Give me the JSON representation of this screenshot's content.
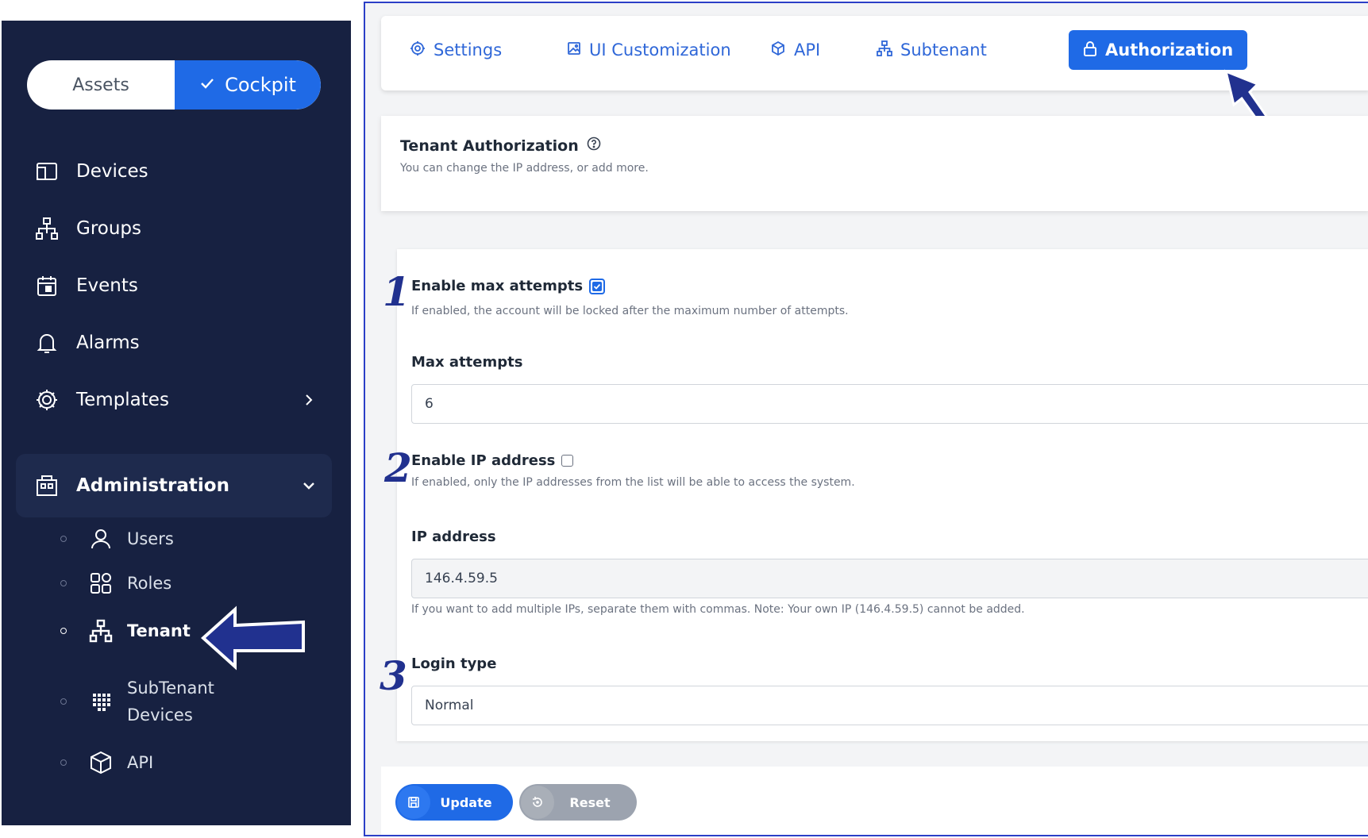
{
  "sidebar": {
    "switch": {
      "assets": "Assets",
      "cockpit": "Cockpit"
    },
    "items": [
      {
        "label": "Devices",
        "icon": "devices-icon"
      },
      {
        "label": "Groups",
        "icon": "groups-icon"
      },
      {
        "label": "Events",
        "icon": "calendar-icon"
      },
      {
        "label": "Alarms",
        "icon": "bell-icon"
      },
      {
        "label": "Templates",
        "icon": "gear-icon"
      },
      {
        "label": "Administration",
        "icon": "admin-icon"
      }
    ],
    "sub_items": [
      {
        "label": "Users",
        "icon": "user-icon"
      },
      {
        "label": "Roles",
        "icon": "roles-icon"
      },
      {
        "label": "Tenant",
        "icon": "tenant-icon"
      },
      {
        "label_line1": "SubTenant",
        "label_line2": "Devices",
        "icon": "grid-icon"
      },
      {
        "label": "API",
        "icon": "cube-icon"
      }
    ]
  },
  "tabs": [
    {
      "label": "Settings",
      "icon": "gear-icon"
    },
    {
      "label": "UI Customization",
      "icon": "image-icon"
    },
    {
      "label": "API",
      "icon": "cube-icon"
    },
    {
      "label": "Subtenant",
      "icon": "tenant-icon"
    },
    {
      "label": "Authorization",
      "icon": "lock-icon"
    }
  ],
  "auth": {
    "title": "Tenant Authorization",
    "desc": "You can change the IP address, or add more."
  },
  "form": {
    "max_attempts_enable": {
      "label": "Enable max attempts",
      "help": "If enabled, the account will be locked after the maximum number of attempts.",
      "checked": true
    },
    "max_attempts": {
      "label": "Max attempts",
      "value": "6"
    },
    "ip_enable": {
      "label": "Enable IP address",
      "help": "If enabled, only the IP addresses from the list will be able to access the system.",
      "checked": false
    },
    "ip_address": {
      "label": "IP address",
      "value": "146.4.59.5",
      "help": "If you want to add multiple IPs, separate them with commas. Note: Your own IP (146.4.59.5) cannot be added."
    },
    "login_type": {
      "label": "Login type",
      "value": "Normal"
    }
  },
  "annotations": {
    "n1": "1",
    "n2": "2",
    "n3": "3"
  },
  "buttons": {
    "update": "Update",
    "reset": "Reset"
  },
  "colors": {
    "sidebar_bg": "#172141",
    "accent": "#1f6ae6",
    "annotation": "#21318f"
  }
}
